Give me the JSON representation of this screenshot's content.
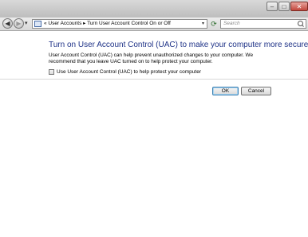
{
  "window": {
    "minimize_glyph": "–",
    "maximize_glyph": "□",
    "close_glyph": "✕"
  },
  "nav": {
    "back_glyph": "◀",
    "forward_glyph": "▶",
    "dropdown_glyph": "▾"
  },
  "address": {
    "icon": "control-panel-icon",
    "overflow": "«",
    "crumbs": [
      "User Accounts",
      "Turn User Account Control On or Off"
    ],
    "separator": "▸",
    "text": "« User Accounts ▸ Turn User Account Control On or Off",
    "dropdown_glyph": "▾",
    "refresh_glyph": "⟳"
  },
  "search": {
    "placeholder": "Search",
    "icon": "search-icon"
  },
  "main": {
    "heading": "Turn on User Account Control (UAC) to make your computer more secure",
    "description": "User Account Control (UAC) can help prevent unauthorized changes to your computer.  We recommend that you leave UAC turned on to help protect your computer.",
    "checkbox_label": "Use User Account Control (UAC) to help protect your computer",
    "checkbox_checked": false
  },
  "buttons": {
    "ok": "OK",
    "cancel": "Cancel"
  }
}
